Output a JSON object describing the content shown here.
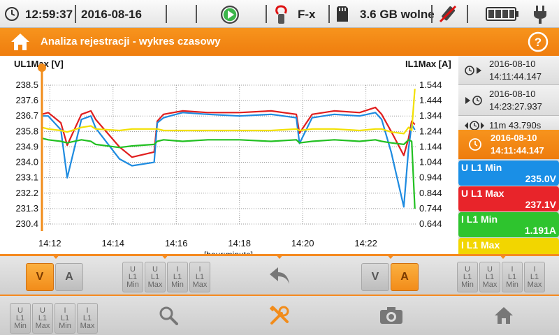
{
  "status": {
    "time": "12:59:37",
    "date": "2016-08-16",
    "clamp_label": "F-x",
    "storage": "3.6 GB wolne",
    "icons": [
      "clock-icon",
      "play-icon",
      "clamp-icon",
      "sd-card-icon",
      "usb-disabled-icon",
      "battery-icon",
      "plug-icon"
    ]
  },
  "header": {
    "title": "Analiza rejestracji - wykres czasowy"
  },
  "chart_data": {
    "type": "line",
    "ylabel_left": "UL1Max [V]",
    "ylabel_right": "IL1Max [A]",
    "xlabel": "[hour:minute]",
    "y_left_ticks": [
      "238.5",
      "237.6",
      "236.7",
      "235.8",
      "234.9",
      "234.0",
      "233.1",
      "232.2",
      "231.3",
      "230.4"
    ],
    "y_right_ticks": [
      "1.544",
      "1.444",
      "1.344",
      "1.244",
      "1.144",
      "1.044",
      "0.944",
      "0.844",
      "0.744",
      "0.644"
    ],
    "x_ticks": [
      "14:12",
      "14:14",
      "14:16",
      "14:18",
      "14:20",
      "14:22"
    ],
    "ylim_left": [
      230.4,
      238.5
    ],
    "ylim_right": [
      0.644,
      1.544
    ],
    "grid": true,
    "x_minutes": [
      11.75,
      11.95,
      12.35,
      12.55,
      13.0,
      13.3,
      13.45,
      14.2,
      14.6,
      15.3,
      15.4,
      15.6,
      16.2,
      17.0,
      18.0,
      19.0,
      19.8,
      19.9,
      20.3,
      21.0,
      21.8,
      22.3,
      22.5,
      22.8,
      23.2,
      23.35,
      23.45,
      23.55
    ],
    "series": [
      {
        "name": "U L1 Max",
        "axis": "left",
        "color": "#e01e1e",
        "values": [
          236.8,
          236.9,
          236.3,
          235.0,
          236.8,
          237.0,
          236.5,
          234.9,
          234.3,
          234.6,
          236.4,
          236.8,
          237.0,
          236.9,
          236.9,
          237.0,
          236.8,
          235.7,
          236.8,
          237.0,
          236.9,
          237.2,
          236.8,
          235.8,
          234.4,
          235.4,
          236.4,
          236.2
        ]
      },
      {
        "name": "U L1 Min",
        "axis": "left",
        "color": "#1e8be0",
        "values": [
          236.7,
          236.7,
          235.9,
          233.1,
          236.5,
          236.7,
          236.0,
          234.2,
          233.8,
          234.0,
          236.3,
          236.6,
          236.9,
          236.8,
          236.7,
          236.8,
          236.6,
          235.1,
          236.6,
          236.8,
          236.7,
          236.9,
          236.5,
          234.6,
          231.4,
          234.8,
          236.2,
          235.9
        ]
      },
      {
        "name": "I L1 Min",
        "axis": "right",
        "color": "#22c022",
        "values": [
          1.2,
          1.19,
          1.18,
          1.17,
          1.19,
          1.18,
          1.16,
          1.14,
          1.15,
          1.16,
          1.18,
          1.19,
          1.18,
          1.19,
          1.19,
          1.18,
          1.19,
          1.17,
          1.18,
          1.19,
          1.18,
          1.19,
          1.18,
          1.17,
          1.16,
          1.19,
          1.18,
          0.744
        ]
      },
      {
        "name": "I L1 Max",
        "axis": "right",
        "color": "#f2e000",
        "values": [
          1.27,
          1.26,
          1.25,
          1.24,
          1.27,
          1.28,
          1.26,
          1.25,
          1.26,
          1.26,
          1.26,
          1.25,
          1.25,
          1.25,
          1.25,
          1.25,
          1.26,
          1.25,
          1.26,
          1.26,
          1.25,
          1.26,
          1.26,
          1.24,
          1.23,
          1.27,
          1.25,
          1.52
        ]
      }
    ]
  },
  "panel": {
    "start_date": "2016-08-10",
    "start_time": "14:11:44.147",
    "end_date": "2016-08-10",
    "end_time": "14:23:27.937",
    "duration": "11m 43.790s",
    "cursor_date": "2016-08-10",
    "cursor_time": "14:11:44.147",
    "measurements": [
      {
        "label": "U L1 Min",
        "value": "235.0V",
        "color": "#1a8fe6"
      },
      {
        "label": "U L1 Max",
        "value": "237.1V",
        "color": "#e8242a"
      },
      {
        "label": "I L1 Min",
        "value": "1.191A",
        "color": "#2ec42e"
      },
      {
        "label": "I L1 Max",
        "value": "",
        "color": "#f2d600"
      }
    ]
  },
  "toolbar1": {
    "left_units": [
      "V",
      "A"
    ],
    "left_params": [
      "U\nL1\nMin",
      "U\nL1\nMax",
      "I\nL1\nMin",
      "I\nL1\nMax"
    ],
    "right_units": [
      "V",
      "A"
    ],
    "right_params": [
      "U\nL1\nMin",
      "U\nL1\nMax",
      "I\nL1\nMin",
      "I\nL1\nMax"
    ]
  },
  "toolbar2": {
    "params": [
      "U\nL1\nMin",
      "U\nL1\nMax",
      "I\nL1\nMin",
      "I\nL1\nMax"
    ]
  }
}
